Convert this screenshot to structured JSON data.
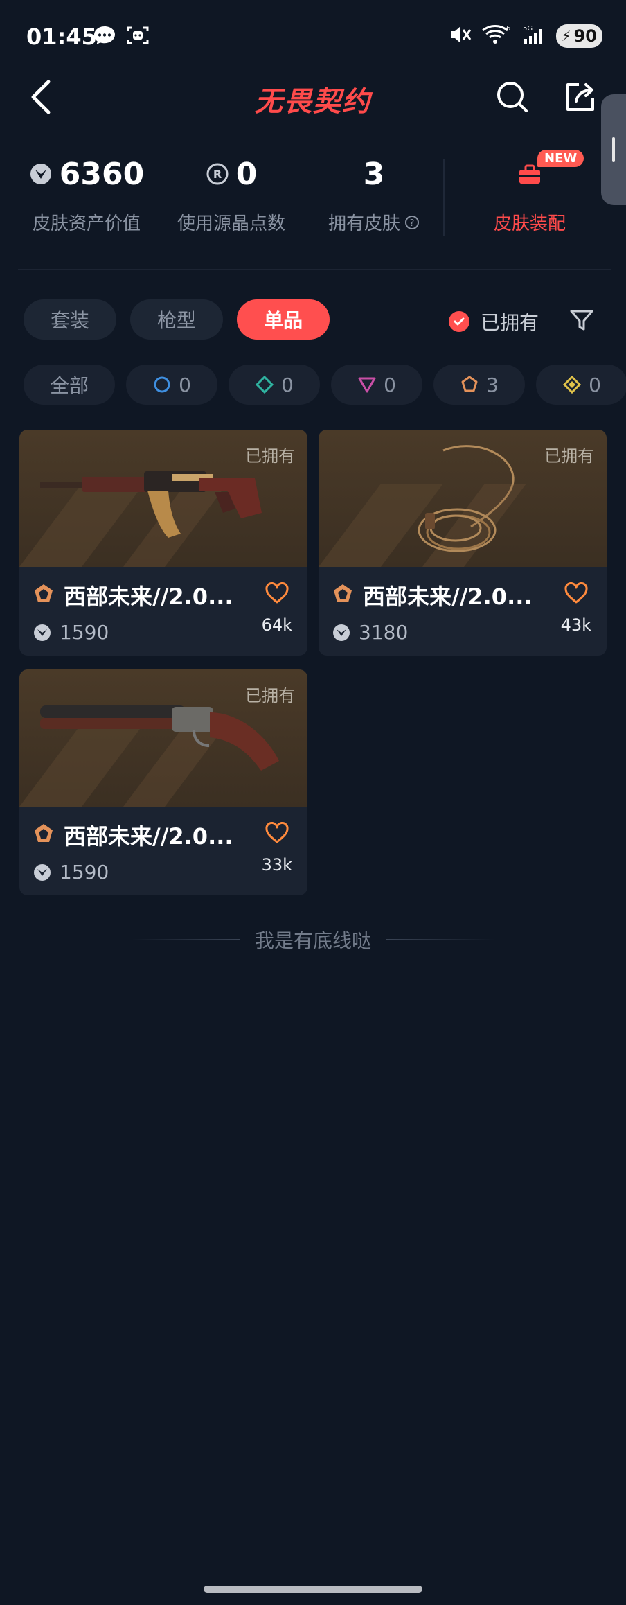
{
  "status_bar": {
    "time": "01:45",
    "network": "5G",
    "battery": "90"
  },
  "nav": {
    "title": "无畏契约"
  },
  "stats": [
    {
      "value": "6360",
      "label": "皮肤资产价值",
      "icon": "vp-currency-icon"
    },
    {
      "value": "0",
      "label": "使用源晶点数",
      "icon": "radianite-icon"
    },
    {
      "value": "3",
      "label": "拥有皮肤",
      "icon": "help-icon"
    }
  ],
  "outfit": {
    "badge": "NEW",
    "label": "皮肤装配"
  },
  "tabs": [
    {
      "label": "套装",
      "active": false
    },
    {
      "label": "枪型",
      "active": false
    },
    {
      "label": "单品",
      "active": true
    }
  ],
  "owned_filter": {
    "label": "已拥有",
    "checked": true
  },
  "rarity_chips": [
    {
      "label": "全部"
    },
    {
      "label": "0",
      "color": "#3f8fe0"
    },
    {
      "label": "0",
      "color": "#2fb3a0"
    },
    {
      "label": "0",
      "color": "#c94fa6"
    },
    {
      "label": "3",
      "color": "#e4925a"
    },
    {
      "label": "0",
      "color": "#e0c24a"
    }
  ],
  "cards": [
    {
      "tag": "已拥有",
      "name": "西部未来//2.0...",
      "price": "1590",
      "likes": "64k",
      "rarity_color": "#e4925a"
    },
    {
      "tag": "已拥有",
      "name": "西部未来//2.0...",
      "price": "3180",
      "likes": "43k",
      "rarity_color": "#e4925a"
    },
    {
      "tag": "已拥有",
      "name": "西部未来//2.0...",
      "price": "1590",
      "likes": "33k",
      "rarity_color": "#e4925a"
    }
  ],
  "footer": {
    "text": "我是有底线哒"
  }
}
